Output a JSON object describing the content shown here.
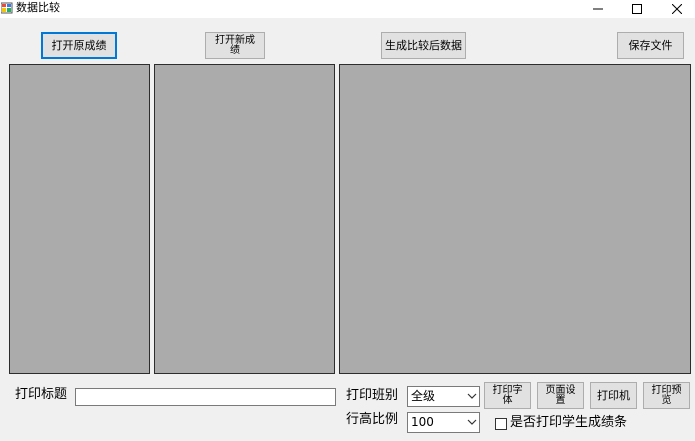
{
  "window": {
    "title": "数据比较",
    "minimize_glyph": "─",
    "maximize_glyph": "☐",
    "close_glyph": "✕"
  },
  "toolbar": {
    "open_original": "打开原成绩",
    "open_new": "打开新成\n绩",
    "generate": "生成比较后数据",
    "save": "保存文件"
  },
  "bottom": {
    "print_title_label": "打印标题",
    "print_title_value": "",
    "print_class_label": "打印班别",
    "print_class_value": "全级",
    "row_height_label": "行高比例",
    "row_height_value": "100",
    "print_font": "打印字\n体",
    "page_setup": "页面设\n置",
    "printer": "打印机",
    "print_preview": "打印预\n览",
    "print_student_bar_label": "是否打印学生成绩条",
    "print_student_bar_checked": false
  },
  "icons": [
    "app-icon",
    "minimize-icon",
    "maximize-icon",
    "close-icon",
    "dropdown-arrow-icon"
  ]
}
